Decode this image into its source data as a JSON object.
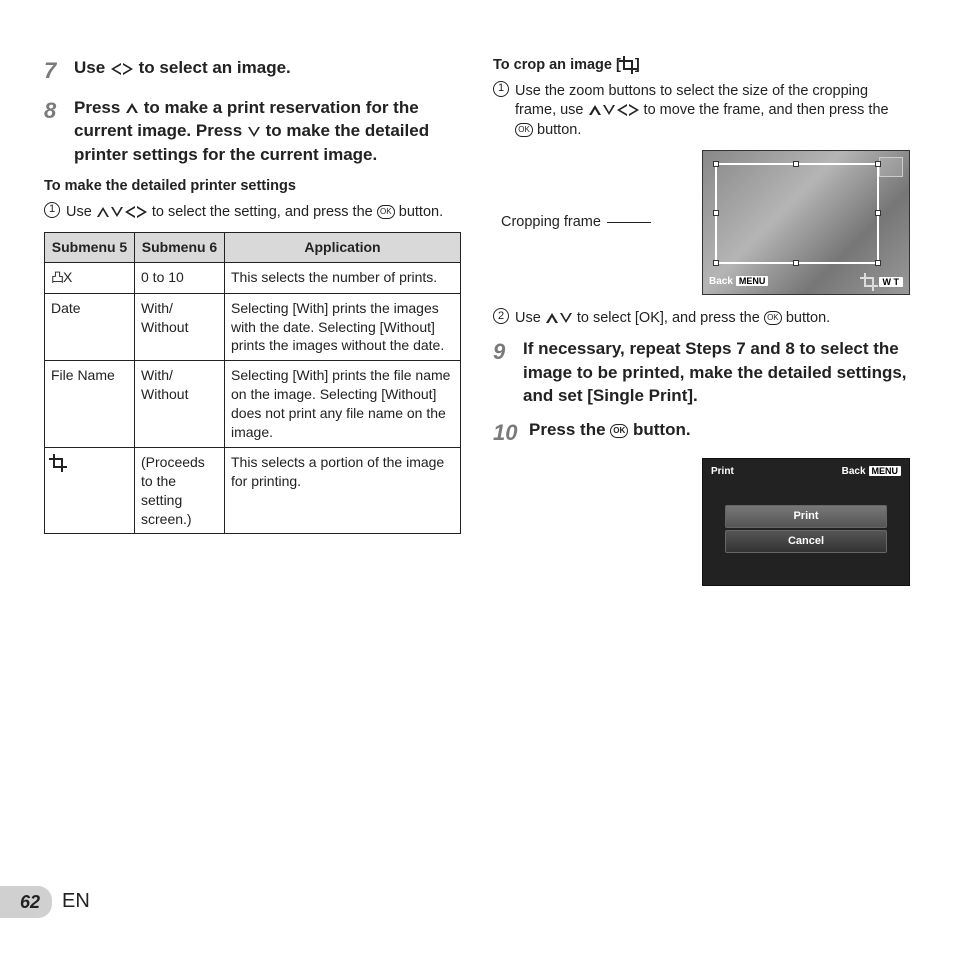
{
  "left": {
    "step7": {
      "num": "7",
      "text_a": "Use ",
      "text_b": " to select an image."
    },
    "step8": {
      "num": "8",
      "text_a": "Press ",
      "text_b": " to make a print reservation for the current image. Press ",
      "text_c": " to make the detailed printer settings for the current image."
    },
    "detailed_heading": "To make the detailed printer settings",
    "detailed_sub": {
      "circled": "1",
      "prefix": "Use ",
      "mid": " to select the setting, and press the ",
      "suffix": " button."
    },
    "table": {
      "headers": [
        "Submenu 5",
        "Submenu 6",
        "Application"
      ],
      "rows": [
        {
          "c1_icon": "print-order",
          "c1_text": "X",
          "c2": "0 to 10",
          "c3": "This selects the number of prints."
        },
        {
          "c1": "Date",
          "c2": "With/\nWithout",
          "c3": "Selecting [With] prints the images with the date. Selecting [Without] prints the images without the date."
        },
        {
          "c1": "File Name",
          "c2": "With/\nWithout",
          "c3": "Selecting [With] prints the file name on the image. Selecting [Without] does not print any file name on the image."
        },
        {
          "c1_icon": "crop",
          "c2": "(Proceeds to the setting screen.)",
          "c3": "This selects a portion of the image for printing."
        }
      ]
    }
  },
  "right": {
    "crop_heading_a": "To crop an image [",
    "crop_heading_b": "]",
    "crop_sub1": {
      "circled": "1",
      "prefix": "Use the zoom buttons to select the size of the cropping frame, use ",
      "mid": " to move the frame, and then press the ",
      "suffix": " button."
    },
    "crop_label": "Cropping frame",
    "crop_bottom": {
      "back": "Back",
      "menu": "MENU",
      "wt": "W T"
    },
    "crop_sub2": {
      "circled": "2",
      "prefix": "Use ",
      "mid": " to select [OK], and press the ",
      "suffix": " button."
    },
    "step9": {
      "num": "9",
      "text": "If necessary, repeat Steps 7 and 8 to select the image to be printed, make the detailed settings, and set [Single Print]."
    },
    "step10": {
      "num": "10",
      "text_a": "Press the ",
      "text_b": " button."
    },
    "print_screen": {
      "title": "Print",
      "back": "Back",
      "menu": "MENU",
      "opt1": "Print",
      "opt2": "Cancel"
    }
  },
  "footer": {
    "page": "62",
    "lang": "EN"
  },
  "icons": {
    "ok": "OK"
  }
}
